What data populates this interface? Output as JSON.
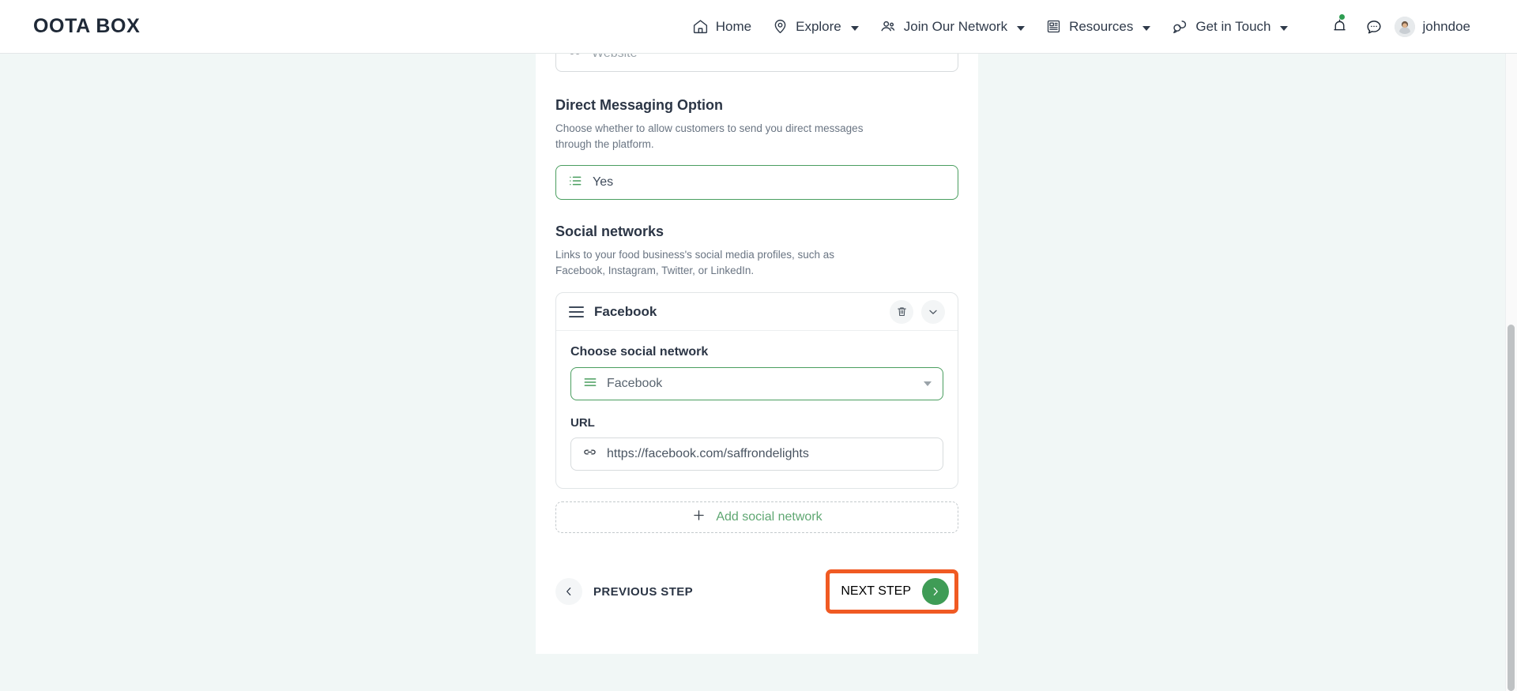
{
  "brand": "OOTA BOX",
  "nav": {
    "items": [
      {
        "label": "Home",
        "icon": "home-icon",
        "caret": false
      },
      {
        "label": "Explore",
        "icon": "location-pin-icon",
        "caret": true
      },
      {
        "label": "Join Our Network",
        "icon": "people-icon",
        "caret": true
      },
      {
        "label": "Resources",
        "icon": "article-icon",
        "caret": true
      },
      {
        "label": "Get in Touch",
        "icon": "chat-bubbles-icon",
        "caret": true
      }
    ],
    "notifications_icon": "bell-icon",
    "messages_icon": "message-bubble-icon",
    "user": "johndoe",
    "user_avatar_icon": "avatar-icon"
  },
  "form": {
    "website_field": {
      "icon": "link-icon",
      "placeholder": "Website",
      "value": ""
    },
    "direct_messaging": {
      "title": "Direct Messaging Option",
      "description": "Choose whether to allow customers to send you direct messages through the platform.",
      "icon": "list-icon",
      "value": "Yes"
    },
    "social_networks": {
      "title": "Social networks",
      "description": "Links to your food business's social media profiles, such as Facebook, Instagram, Twitter, or LinkedIn.",
      "cards": [
        {
          "drag_icon": "drag-handle-icon",
          "header_title": "Facebook",
          "delete_icon": "trash-icon",
          "collapse_icon": "chevron-down-icon",
          "choose_label": "Choose social network",
          "choose_icon": "list-icon",
          "choose_value": "Facebook",
          "url_label": "URL",
          "url_icon": "link-icon",
          "url_value": "https://facebook.com/saffrondelights"
        }
      ],
      "add_button": {
        "icon": "plus-icon",
        "label": "Add social network"
      }
    },
    "footer": {
      "previous_icon": "chevron-left-icon",
      "previous_label": "PREVIOUS STEP",
      "next_label": "NEXT STEP",
      "next_icon": "chevron-right-icon"
    }
  },
  "colors": {
    "brand_green": "#3f9c56",
    "highlight_orange": "#f05a23",
    "page_bg": "#f1f7f6",
    "text_dark": "#2b3545"
  }
}
